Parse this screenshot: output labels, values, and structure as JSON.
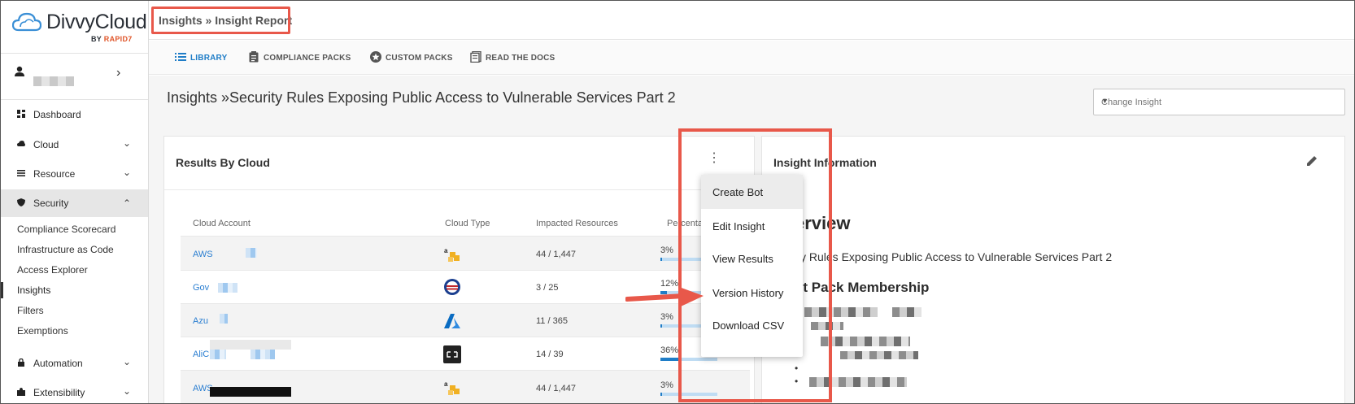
{
  "brand": {
    "name": "DivvyCloud",
    "by": "BY",
    "by_brand": "RAPID7"
  },
  "colors": {
    "accent": "#1f7dc7",
    "annotation": "#e8584a",
    "active_bg": "#e6e6e6"
  },
  "sidebar": {
    "items": [
      {
        "label": "Dashboard",
        "icon": "dashboard-icon"
      },
      {
        "label": "Cloud",
        "icon": "cloud-icon"
      },
      {
        "label": "Resource",
        "icon": "list-icon"
      },
      {
        "label": "Security",
        "icon": "shield-icon"
      },
      {
        "label": "Automation",
        "icon": "lock-icon"
      },
      {
        "label": "Extensibility",
        "icon": "puzzle-icon"
      }
    ],
    "security_sub": [
      "Compliance Scorecard",
      "Infrastructure as Code",
      "Access Explorer",
      "Insights",
      "Filters",
      "Exemptions"
    ]
  },
  "header": {
    "breadcrumb": "Insights » Insight Report"
  },
  "tabs": [
    {
      "label": "LIBRARY",
      "icon": "list-icon"
    },
    {
      "label": "COMPLIANCE PACKS",
      "icon": "clipboard-icon"
    },
    {
      "label": "CUSTOM PACKS",
      "icon": "star-icon"
    },
    {
      "label": "READ THE DOCS",
      "icon": "docs-icon"
    }
  ],
  "main": {
    "title": "Insights »Security Rules Exposing Public Access to Vulnerable Services Part 2",
    "change_insight_placeholder": "Change Insight"
  },
  "results": {
    "title": "Results By Cloud",
    "columns": [
      "Cloud Account",
      "Cloud Type",
      "Impacted Resources",
      "Percenta"
    ],
    "rows": [
      {
        "account": "AWS",
        "impacted": "44 / 1,447",
        "percent": "3%",
        "fill": 0.03
      },
      {
        "account": "Gov",
        "impacted": "3 / 25",
        "percent": "12%",
        "fill": 0.12
      },
      {
        "account": "Azu",
        "impacted": "11 / 365",
        "percent": "3%",
        "fill": 0.03
      },
      {
        "account": "AliC",
        "impacted": "14 / 39",
        "percent": "36%",
        "fill": 0.36
      },
      {
        "account": "AWS",
        "impacted": "44 / 1,447",
        "percent": "3%",
        "fill": 0.03
      }
    ]
  },
  "menu": {
    "items": [
      "Create Bot",
      "Edit Insight",
      "View Results",
      "Version History",
      "Download CSV"
    ]
  },
  "info": {
    "title": "Insight Information",
    "overview_head": "erview",
    "overview_text": "ity Rules Exposing Public Access to Vulnerable Services Part 2",
    "pack_head": "ht Pack Membership"
  }
}
